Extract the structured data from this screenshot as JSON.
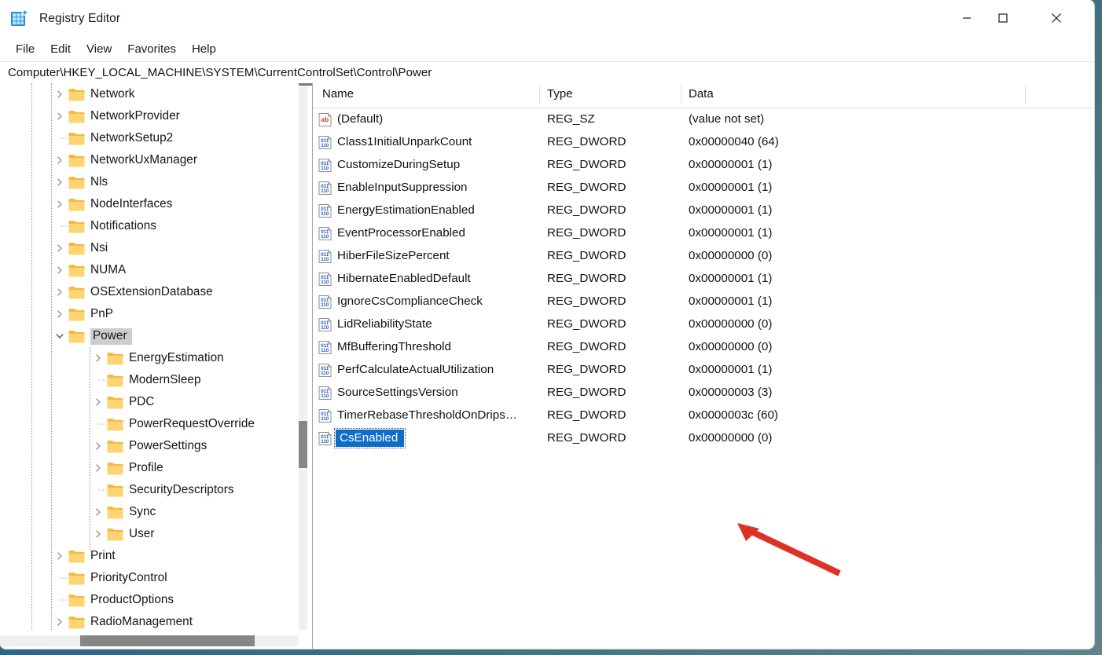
{
  "window": {
    "title": "Registry Editor",
    "icon": "registry-editor-icon",
    "controls": {
      "minimize": "—",
      "maximize": "□",
      "close": "✕"
    }
  },
  "menubar": {
    "items": [
      {
        "label": "File"
      },
      {
        "label": "Edit"
      },
      {
        "label": "View"
      },
      {
        "label": "Favorites"
      },
      {
        "label": "Help"
      }
    ]
  },
  "address": {
    "path": "Computer\\HKEY_LOCAL_MACHINE\\SYSTEM\\CurrentControlSet\\Control\\Power"
  },
  "tree": {
    "nodes": [
      {
        "label": "Network",
        "depth": 1,
        "expandable": true,
        "expanded": false,
        "selected": false
      },
      {
        "label": "NetworkProvider",
        "depth": 1,
        "expandable": true,
        "expanded": false,
        "selected": false
      },
      {
        "label": "NetworkSetup2",
        "depth": 1,
        "expandable": false,
        "expanded": false,
        "selected": false
      },
      {
        "label": "NetworkUxManager",
        "depth": 1,
        "expandable": true,
        "expanded": false,
        "selected": false
      },
      {
        "label": "Nls",
        "depth": 1,
        "expandable": true,
        "expanded": false,
        "selected": false
      },
      {
        "label": "NodeInterfaces",
        "depth": 1,
        "expandable": true,
        "expanded": false,
        "selected": false
      },
      {
        "label": "Notifications",
        "depth": 1,
        "expandable": false,
        "expanded": false,
        "selected": false
      },
      {
        "label": "Nsi",
        "depth": 1,
        "expandable": true,
        "expanded": false,
        "selected": false
      },
      {
        "label": "NUMA",
        "depth": 1,
        "expandable": true,
        "expanded": false,
        "selected": false
      },
      {
        "label": "OSExtensionDatabase",
        "depth": 1,
        "expandable": true,
        "expanded": false,
        "selected": false
      },
      {
        "label": "PnP",
        "depth": 1,
        "expandable": true,
        "expanded": false,
        "selected": false
      },
      {
        "label": "Power",
        "depth": 1,
        "expandable": true,
        "expanded": true,
        "selected": true
      },
      {
        "label": "EnergyEstimation",
        "depth": 2,
        "expandable": true,
        "expanded": false,
        "selected": false
      },
      {
        "label": "ModernSleep",
        "depth": 2,
        "expandable": false,
        "expanded": false,
        "selected": false
      },
      {
        "label": "PDC",
        "depth": 2,
        "expandable": true,
        "expanded": false,
        "selected": false
      },
      {
        "label": "PowerRequestOverride",
        "depth": 2,
        "expandable": false,
        "expanded": false,
        "selected": false
      },
      {
        "label": "PowerSettings",
        "depth": 2,
        "expandable": true,
        "expanded": false,
        "selected": false
      },
      {
        "label": "Profile",
        "depth": 2,
        "expandable": true,
        "expanded": false,
        "selected": false
      },
      {
        "label": "SecurityDescriptors",
        "depth": 2,
        "expandable": false,
        "expanded": false,
        "selected": false
      },
      {
        "label": "Sync",
        "depth": 2,
        "expandable": true,
        "expanded": false,
        "selected": false
      },
      {
        "label": "User",
        "depth": 2,
        "expandable": true,
        "expanded": false,
        "selected": false
      },
      {
        "label": "Print",
        "depth": 1,
        "expandable": true,
        "expanded": false,
        "selected": false
      },
      {
        "label": "PriorityControl",
        "depth": 1,
        "expandable": false,
        "expanded": false,
        "selected": false
      },
      {
        "label": "ProductOptions",
        "depth": 1,
        "expandable": false,
        "expanded": false,
        "selected": false
      },
      {
        "label": "RadioManagement",
        "depth": 1,
        "expandable": true,
        "expanded": false,
        "selected": false
      }
    ]
  },
  "list": {
    "columns": [
      "Name",
      "Type",
      "Data"
    ],
    "rows": [
      {
        "name": "(Default)",
        "type": "REG_SZ",
        "data": "(value not set)",
        "icon": "string-value-icon",
        "editing": false
      },
      {
        "name": "Class1InitialUnparkCount",
        "type": "REG_DWORD",
        "data": "0x00000040 (64)",
        "icon": "dword-value-icon",
        "editing": false
      },
      {
        "name": "CustomizeDuringSetup",
        "type": "REG_DWORD",
        "data": "0x00000001 (1)",
        "icon": "dword-value-icon",
        "editing": false
      },
      {
        "name": "EnableInputSuppression",
        "type": "REG_DWORD",
        "data": "0x00000001 (1)",
        "icon": "dword-value-icon",
        "editing": false
      },
      {
        "name": "EnergyEstimationEnabled",
        "type": "REG_DWORD",
        "data": "0x00000001 (1)",
        "icon": "dword-value-icon",
        "editing": false
      },
      {
        "name": "EventProcessorEnabled",
        "type": "REG_DWORD",
        "data": "0x00000001 (1)",
        "icon": "dword-value-icon",
        "editing": false
      },
      {
        "name": "HiberFileSizePercent",
        "type": "REG_DWORD",
        "data": "0x00000000 (0)",
        "icon": "dword-value-icon",
        "editing": false
      },
      {
        "name": "HibernateEnabledDefault",
        "type": "REG_DWORD",
        "data": "0x00000001 (1)",
        "icon": "dword-value-icon",
        "editing": false
      },
      {
        "name": "IgnoreCsComplianceCheck",
        "type": "REG_DWORD",
        "data": "0x00000001 (1)",
        "icon": "dword-value-icon",
        "editing": false
      },
      {
        "name": "LidReliabilityState",
        "type": "REG_DWORD",
        "data": "0x00000000 (0)",
        "icon": "dword-value-icon",
        "editing": false
      },
      {
        "name": "MfBufferingThreshold",
        "type": "REG_DWORD",
        "data": "0x00000000 (0)",
        "icon": "dword-value-icon",
        "editing": false
      },
      {
        "name": "PerfCalculateActualUtilization",
        "type": "REG_DWORD",
        "data": "0x00000001 (1)",
        "icon": "dword-value-icon",
        "editing": false
      },
      {
        "name": "SourceSettingsVersion",
        "type": "REG_DWORD",
        "data": "0x00000003 (3)",
        "icon": "dword-value-icon",
        "editing": false
      },
      {
        "name": "TimerRebaseThresholdOnDrips…",
        "type": "REG_DWORD",
        "data": "0x0000003c (60)",
        "icon": "dword-value-icon",
        "editing": false
      },
      {
        "name": "CsEnabled",
        "type": "REG_DWORD",
        "data": "0x00000000 (0)",
        "icon": "dword-value-icon",
        "editing": true
      }
    ]
  },
  "annotation": {
    "shape": "red-arrow",
    "color": "#e03127",
    "points_to": "CsEnabled"
  },
  "colors": {
    "selection_blue": "#0d6ec9",
    "folder_yellow": "#fbc74d",
    "tree_selected_gray": "#cdcdcd",
    "desktop": "#2a5f86"
  }
}
